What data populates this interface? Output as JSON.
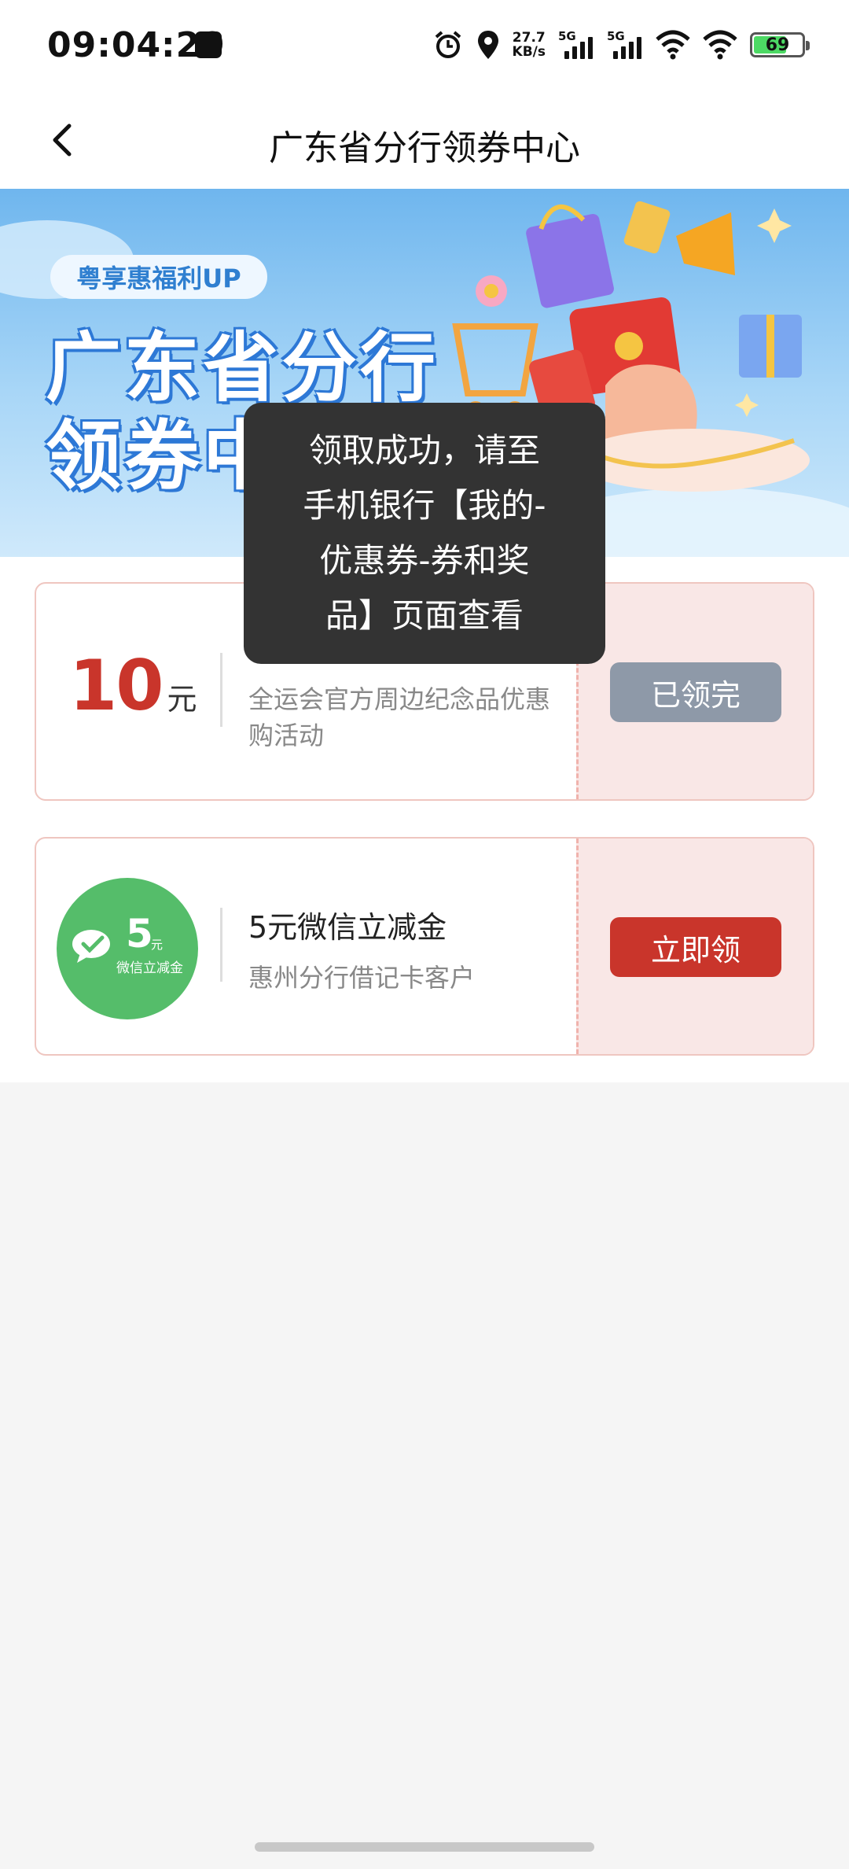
{
  "status_bar": {
    "time": "09:04:29",
    "net_speed_value": "27.7",
    "net_speed_unit": "KB/s",
    "sim1_type": "5G",
    "sim2_type": "5G",
    "battery": "69",
    "battery_level": 0.69,
    "icons": [
      "app-notification-icon",
      "alarm-icon",
      "location-icon",
      "signal-icon",
      "wifi-icon",
      "battery-icon"
    ]
  },
  "header": {
    "title": "广东省分行领券中心"
  },
  "banner": {
    "badge": "粤享惠福利UP",
    "title_line1": "广东省分行",
    "title_line2": "领券中心"
  },
  "coupons": [
    {
      "amount": "10",
      "unit": "元",
      "description": "全运会官方周边纪念品优惠购活动",
      "button": "已领完",
      "state": "claimed"
    },
    {
      "icon_amount": "5",
      "icon_unit": "元",
      "icon_label": "微信立减金",
      "title": "5元微信立减金",
      "subtitle": "惠州分行借记卡客户",
      "button": "立即领",
      "state": "available"
    }
  ],
  "toast": {
    "line1": "领取成功，请至",
    "line2": "手机银行【我的-",
    "line3": "优惠券-券和奖",
    "line4": "品】页面查看"
  },
  "colors": {
    "accent_red": "#c9352b",
    "disabled_gray": "#8e99a8",
    "wechat_green": "#55bd6a",
    "coupon_right_bg": "#f9e7e6"
  }
}
